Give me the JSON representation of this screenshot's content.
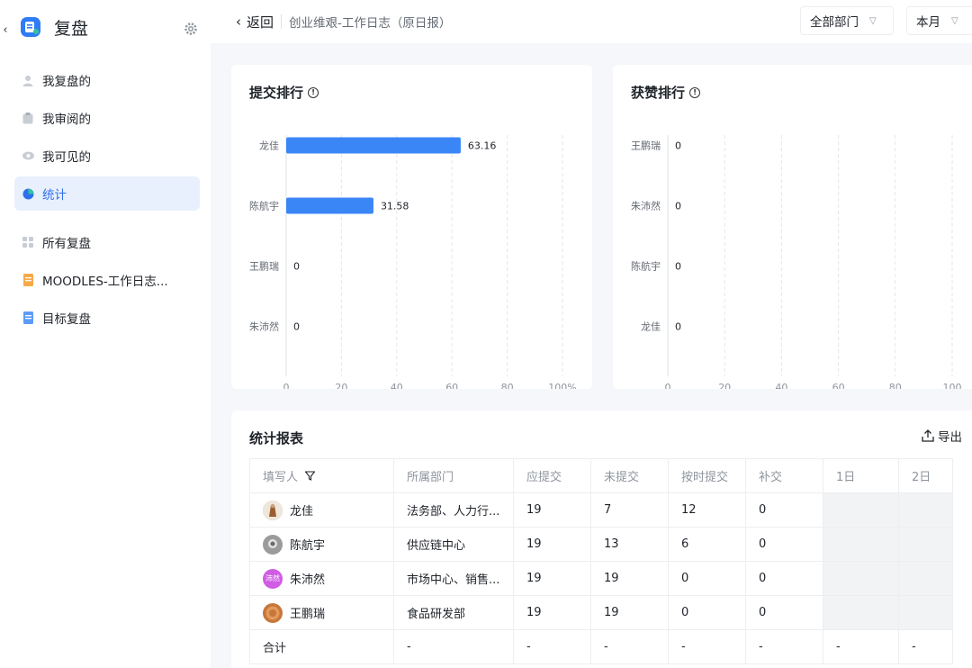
{
  "app": {
    "name": "复盘"
  },
  "sidebar": {
    "items": [
      {
        "label": "我复盘的",
        "icon": "person-icon"
      },
      {
        "label": "我审阅的",
        "icon": "clipboard-icon"
      },
      {
        "label": "我可见的",
        "icon": "eye-icon"
      },
      {
        "label": "统计",
        "icon": "pie-chart-icon",
        "active": true
      },
      {
        "label": "所有复盘",
        "icon": "grid-icon"
      },
      {
        "label": "MOODLES-工作日志...",
        "icon": "orange-doc-icon"
      },
      {
        "label": "目标复盘",
        "icon": "blue-doc-icon"
      }
    ]
  },
  "header": {
    "back_label": "返回",
    "title": "创业维艰-工作日志（原日报）",
    "department_select": "全部部门",
    "period_select": "本月"
  },
  "submit_rank": {
    "title": "提交排行",
    "chart_data": {
      "type": "bar",
      "orientation": "horizontal",
      "categories": [
        "龙佳",
        "陈航宇",
        "王鹏瑞",
        "朱沛然"
      ],
      "values": [
        63.16,
        31.58,
        0,
        0
      ],
      "value_labels": [
        "63.16",
        "31.58",
        "0",
        "0"
      ],
      "xlim": [
        0,
        100
      ],
      "xticks": [
        "0",
        "20",
        "40",
        "60",
        "80",
        "100%"
      ],
      "bar_color": "#3b86f7",
      "grid": true
    }
  },
  "like_rank": {
    "title": "获赞排行",
    "chart_data": {
      "type": "bar",
      "orientation": "horizontal",
      "categories": [
        "王鹏瑞",
        "朱沛然",
        "陈航宇",
        "龙佳"
      ],
      "values": [
        0,
        0,
        0,
        0
      ],
      "value_labels": [
        "0",
        "0",
        "0",
        "0"
      ],
      "xlim": [
        0,
        100
      ],
      "xticks": [
        "0",
        "20",
        "40",
        "60",
        "80",
        "100"
      ],
      "bar_color": "#3b86f7",
      "grid": true
    }
  },
  "report": {
    "title": "统计报表",
    "export_label": "导出",
    "columns": [
      "填写人",
      "所属部门",
      "应提交",
      "未提交",
      "按时提交",
      "补交",
      "1日",
      "2日"
    ],
    "rows": [
      {
        "name": "龙佳",
        "dept": "法务部、人力行...",
        "due": "19",
        "missing": "7",
        "ontime": "12",
        "late": "0",
        "avatar_color": "#c9a27e"
      },
      {
        "name": "陈航宇",
        "dept": "供应链中心",
        "due": "19",
        "missing": "13",
        "ontime": "6",
        "late": "0",
        "avatar_color": "#8c8c8c"
      },
      {
        "name": "朱沛然",
        "dept": "市场中心、销售...",
        "due": "19",
        "missing": "19",
        "ontime": "0",
        "late": "0",
        "avatar_color": "#d05ce3",
        "avatar_text": "沛然"
      },
      {
        "name": "王鹏瑞",
        "dept": "食品研发部",
        "due": "19",
        "missing": "19",
        "ontime": "0",
        "late": "0",
        "avatar_color": "#c7773a"
      }
    ],
    "total": {
      "label": "合计",
      "dept": "-",
      "due": "-",
      "missing": "-",
      "ontime": "-",
      "late": "-",
      "d1": "-",
      "d2": "-"
    }
  }
}
